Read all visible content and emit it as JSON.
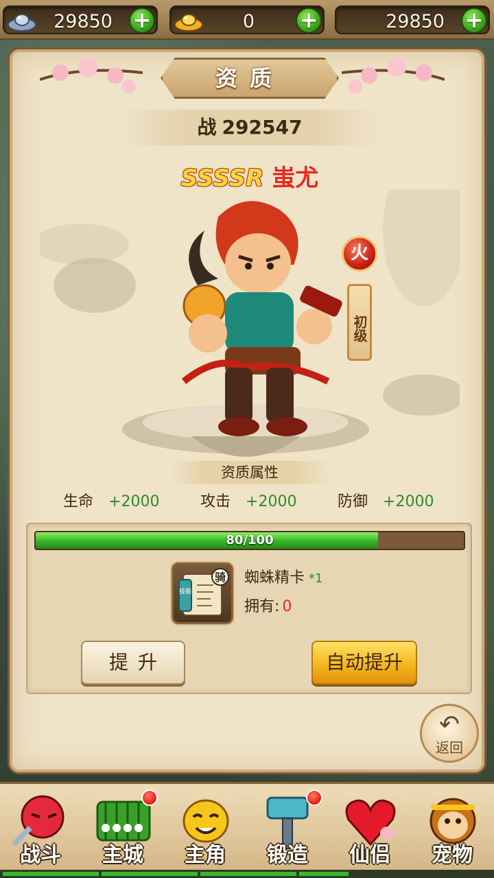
{
  "currency": {
    "silver": {
      "value": "29850",
      "icon": "silver-ingot-icon"
    },
    "gold": {
      "value": "0",
      "icon": "gold-ingot-icon"
    },
    "third": {
      "value": "29850"
    }
  },
  "panel": {
    "title": "资质",
    "power_label": "战",
    "power_value": "292547",
    "hero_rank": "SSSSR",
    "hero_name": "蚩尤",
    "element": "火",
    "grade": "初级"
  },
  "attributes": {
    "title": "资质属性",
    "items": [
      {
        "label": "生命",
        "value": "+2000"
      },
      {
        "label": "攻击",
        "value": "+2000"
      },
      {
        "label": "防御",
        "value": "+2000"
      }
    ]
  },
  "upgrade": {
    "progress_text": "80/100",
    "progress_fraction": 0.8,
    "item_name": "蜘蛛精卡",
    "item_count": "*1",
    "item_badge": "骑",
    "item_scroll_text": "技能",
    "own_label": "拥有:",
    "own_value": "0",
    "upgrade_button": "提升",
    "auto_button": "自动提升"
  },
  "back_label": "返回",
  "nav": [
    {
      "label": "战斗",
      "icon": "battle-icon",
      "dot": false
    },
    {
      "label": "主城",
      "icon": "city-icon",
      "dot": true
    },
    {
      "label": "主角",
      "icon": "hero-icon",
      "dot": false
    },
    {
      "label": "锻造",
      "icon": "forge-hammer-icon",
      "dot": true
    },
    {
      "label": "仙侣",
      "icon": "companion-heart-icon",
      "dot": false
    },
    {
      "label": "宠物",
      "icon": "pet-monkey-icon",
      "dot": false
    }
  ],
  "colors": {
    "accent_green": "#3ab82a",
    "value_red": "#e62a1a",
    "panel_bg": "#efe3c8",
    "auto_button": "#f4b21a"
  }
}
